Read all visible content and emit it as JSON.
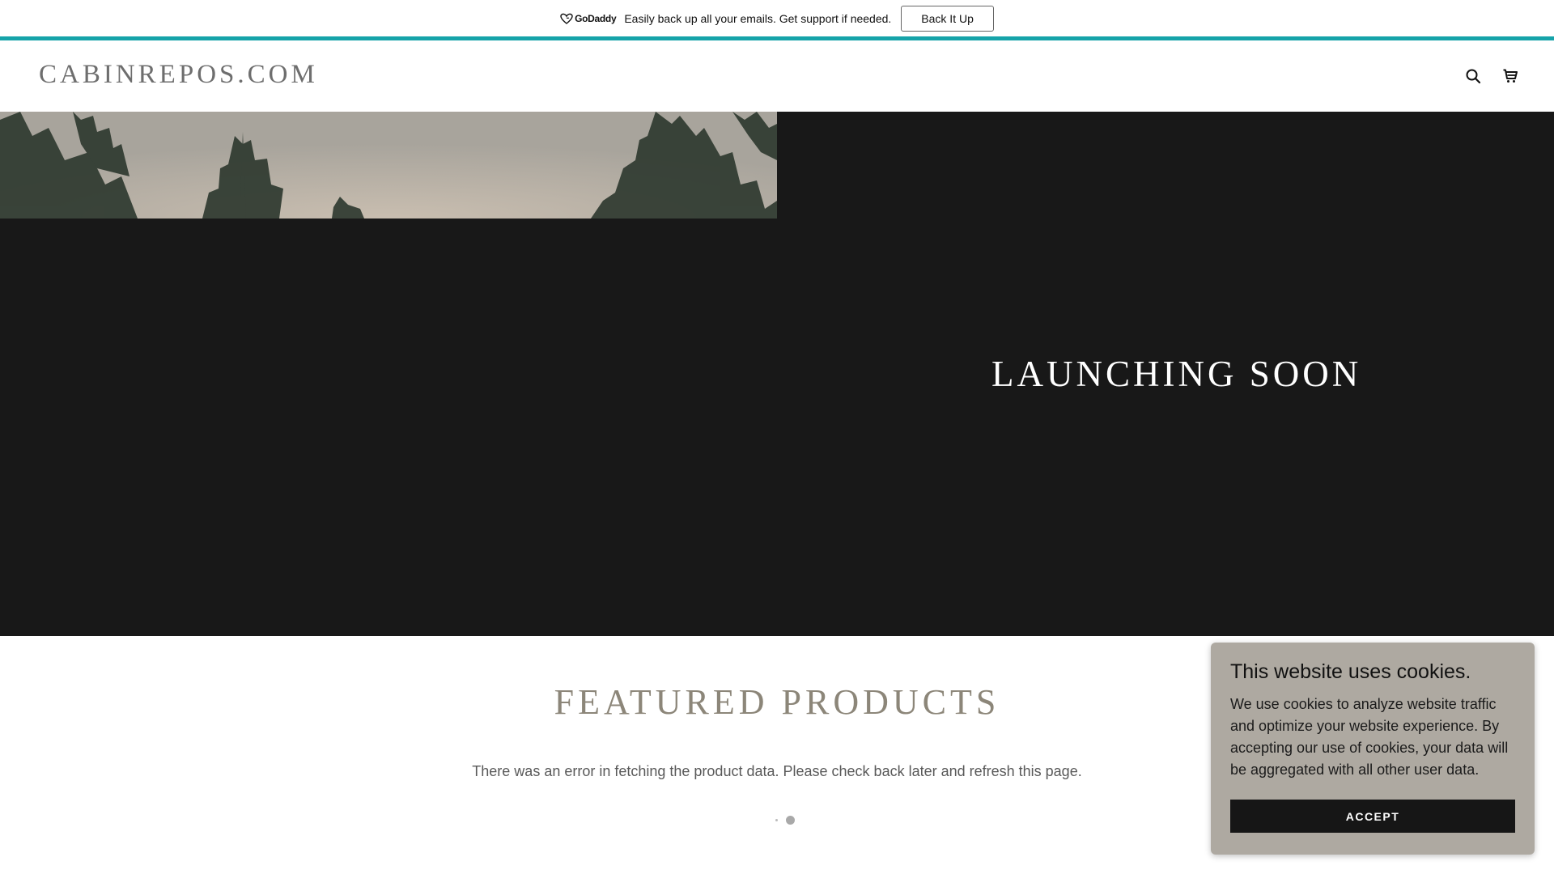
{
  "promo": {
    "brand": "GoDaddy",
    "message": "Easily back up all your emails. Get support if needed.",
    "button_label": "Back It Up",
    "accent_color": "#16a3a9"
  },
  "header": {
    "site_title": "CABINREPOS.COM",
    "icons": [
      "search-icon",
      "cart-icon"
    ]
  },
  "hero": {
    "title": "LAUNCHING SOON",
    "image": "pine-trees-sky"
  },
  "featured": {
    "title": "FEATURED PRODUCTS",
    "message": "There was an error in fetching the product data. Please check back later and refresh this page."
  },
  "cookie": {
    "title": "This website uses cookies.",
    "body": "We use cookies to analyze website traffic and optimize your website experience. By accepting our use of cookies, your data will be aggregated with all other user data.",
    "accept_label": "ACCEPT"
  }
}
